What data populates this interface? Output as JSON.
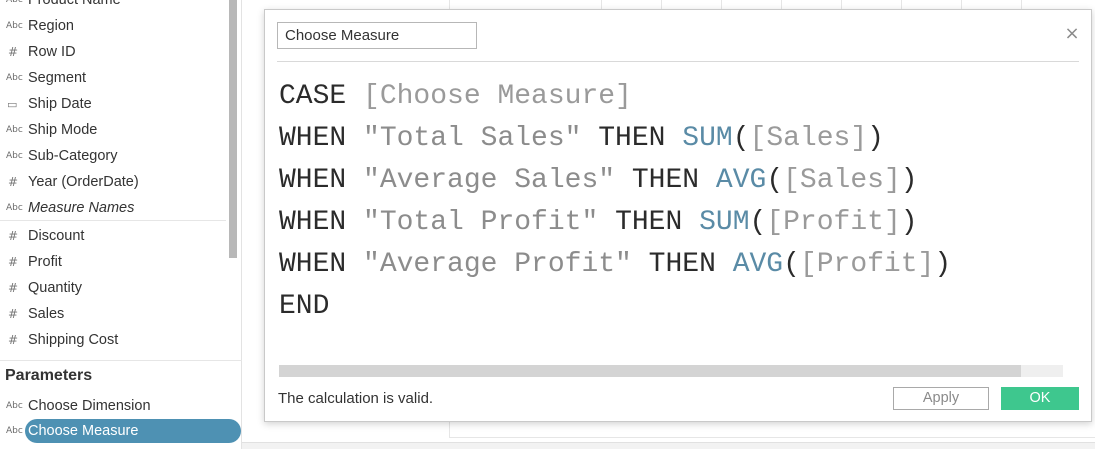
{
  "data_pane": {
    "fields": [
      {
        "icon": "string-type-icon",
        "glyph": "Abc",
        "label": "Product Name"
      },
      {
        "icon": "string-type-icon",
        "glyph": "Abc",
        "label": "Region"
      },
      {
        "icon": "number-type-icon",
        "glyph": "#",
        "label": "Row ID"
      },
      {
        "icon": "string-type-icon",
        "glyph": "Abc",
        "label": "Segment"
      },
      {
        "icon": "date-type-icon",
        "glyph": "▭",
        "label": "Ship Date"
      },
      {
        "icon": "string-type-icon",
        "glyph": "Abc",
        "label": "Ship Mode"
      },
      {
        "icon": "string-type-icon",
        "glyph": "Abc",
        "label": "Sub-Category"
      },
      {
        "icon": "number-type-icon",
        "glyph": "#",
        "label": "Year (OrderDate)"
      },
      {
        "icon": "string-type-icon",
        "glyph": "Abc",
        "label": "Measure Names"
      }
    ],
    "measures": [
      {
        "icon": "number-type-icon",
        "glyph": "#",
        "label": "Discount"
      },
      {
        "icon": "number-type-icon",
        "glyph": "#",
        "label": "Profit"
      },
      {
        "icon": "number-type-icon",
        "glyph": "#",
        "label": "Quantity"
      },
      {
        "icon": "number-type-icon",
        "glyph": "#",
        "label": "Sales"
      },
      {
        "icon": "number-type-icon",
        "glyph": "#",
        "label": "Shipping Cost"
      }
    ],
    "parameters_header": "Parameters",
    "parameters": [
      {
        "icon": "string-type-icon",
        "glyph": "Abc",
        "label": "Choose Dimension",
        "selected": false
      },
      {
        "icon": "string-type-icon",
        "glyph": "Abc",
        "label": "Choose Measure",
        "selected": true
      }
    ]
  },
  "dialog": {
    "calc_name": "Choose Measure",
    "close_glyph": "×",
    "formula_lines": [
      [
        {
          "t": "kw",
          "v": "CASE "
        },
        {
          "t": "fld",
          "v": "[Choose Measure]"
        }
      ],
      [
        {
          "t": "kw",
          "v": "WHEN "
        },
        {
          "t": "str",
          "v": "\"Total Sales\""
        },
        {
          "t": "kw",
          "v": " THEN "
        },
        {
          "t": "fn",
          "v": "SUM"
        },
        {
          "t": "punc",
          "v": "("
        },
        {
          "t": "fld",
          "v": "[Sales]"
        },
        {
          "t": "punc",
          "v": ")"
        }
      ],
      [
        {
          "t": "kw",
          "v": "WHEN "
        },
        {
          "t": "str",
          "v": "\"Average Sales\""
        },
        {
          "t": "kw",
          "v": " THEN "
        },
        {
          "t": "fn",
          "v": "AVG"
        },
        {
          "t": "punc",
          "v": "("
        },
        {
          "t": "fld",
          "v": "[Sales]"
        },
        {
          "t": "punc",
          "v": ")"
        }
      ],
      [
        {
          "t": "kw",
          "v": "WHEN "
        },
        {
          "t": "str",
          "v": "\"Total Profit\""
        },
        {
          "t": "kw",
          "v": " THEN "
        },
        {
          "t": "fn",
          "v": "SUM"
        },
        {
          "t": "punc",
          "v": "("
        },
        {
          "t": "fld",
          "v": "[Profit]"
        },
        {
          "t": "punc",
          "v": ")"
        }
      ],
      [
        {
          "t": "kw",
          "v": "WHEN "
        },
        {
          "t": "str",
          "v": "\"Average Profit\""
        },
        {
          "t": "kw",
          "v": " THEN "
        },
        {
          "t": "fn",
          "v": "AVG"
        },
        {
          "t": "punc",
          "v": "("
        },
        {
          "t": "fld",
          "v": "[Profit]"
        },
        {
          "t": "punc",
          "v": ")"
        }
      ],
      [
        {
          "t": "kw",
          "v": "END"
        }
      ]
    ],
    "validation_message": "The calculation is valid.",
    "apply_label": "Apply",
    "ok_label": "OK"
  },
  "colors": {
    "selected_pill": "#4e91b3",
    "ok_button": "#3ec78e",
    "function_text": "#5a8ba6",
    "string_text": "#8c8c8c"
  }
}
